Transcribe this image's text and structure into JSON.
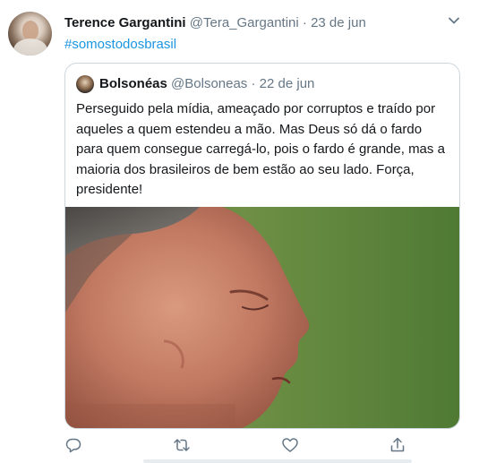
{
  "tweet": {
    "display_name": "Terence Gargantini",
    "handle": "@Tera_Gargantini",
    "separator": "·",
    "date": "23 de jun",
    "hashtag": "#somostodosbrasil",
    "avatar_icon": "user-avatar-photo"
  },
  "quoted": {
    "display_name": "Bolsonéas",
    "handle": "@Bolsoneas",
    "separator": "·",
    "date": "22 de jun",
    "text": "Perseguido pela mídia, ameaçado por corruptos e traído por aqueles a quem estendeu a mão. Mas Deus só dá o fardo para quem consegue carregá-lo, pois o fardo é grande, mas a maioria dos brasileiros de bem estão ao seu lado. Força, presidente!",
    "media_icon": "portrait-photo"
  },
  "actions": {
    "icons": [
      "reply-icon",
      "retweet-icon",
      "like-icon",
      "share-icon"
    ]
  },
  "colors": {
    "link": "#1b95e0",
    "secondary_text": "#657786",
    "border": "#ccd6dd",
    "icon": "#657786"
  }
}
